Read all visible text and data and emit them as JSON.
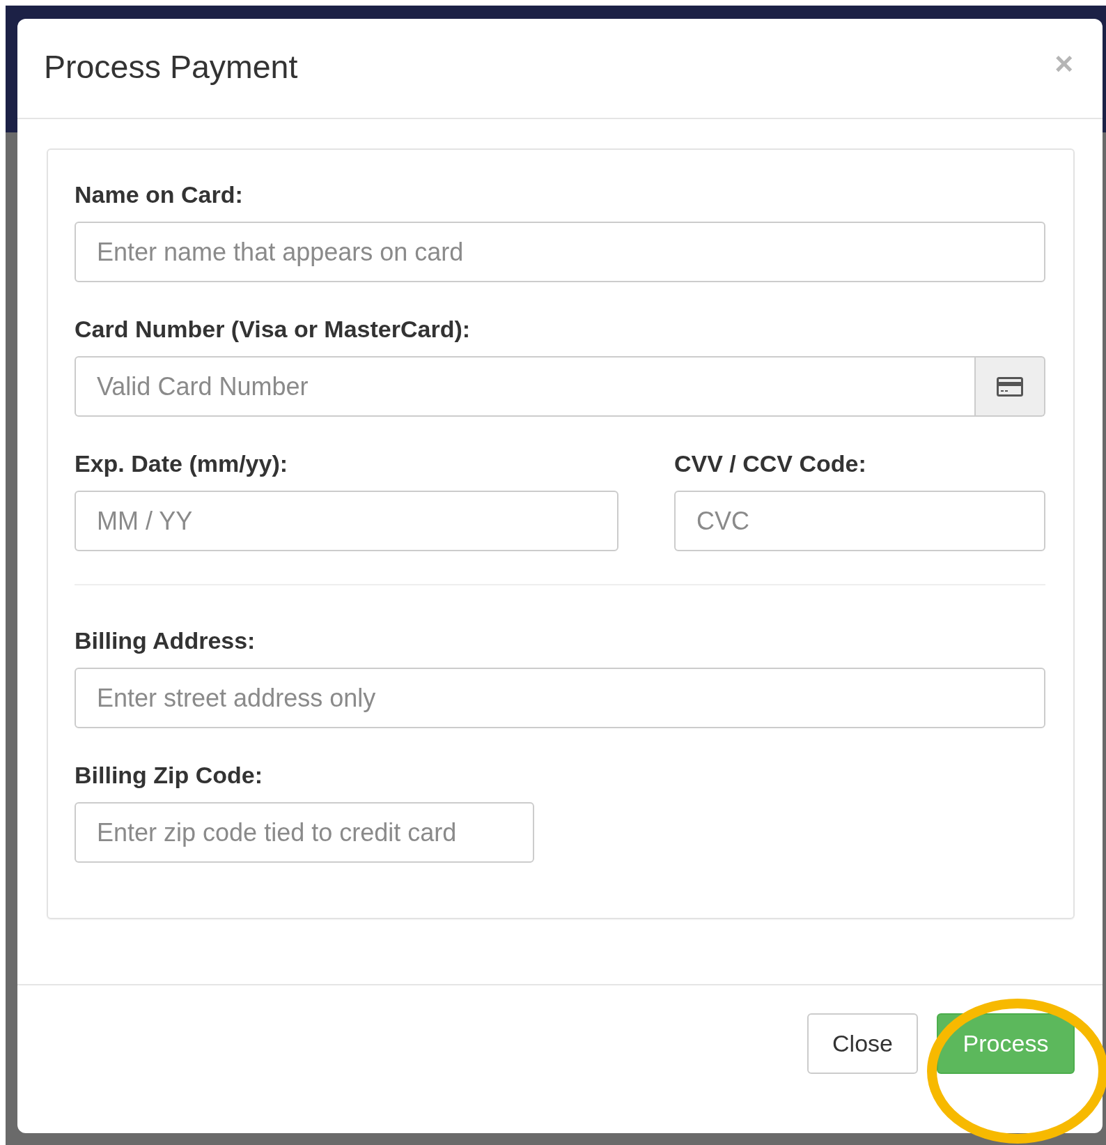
{
  "dialog": {
    "title": "Process Payment",
    "close_symbol": "×"
  },
  "rows": [
    {
      "kind": "single",
      "fields": [
        {
          "label": "Name on Card:",
          "placeholder": "Enter name that appears on card",
          "kind": "text"
        }
      ]
    },
    {
      "kind": "single",
      "fields": [
        {
          "label": "Card Number (Visa or MasterCard):",
          "placeholder": "Valid Card Number",
          "kind": "card-number"
        }
      ]
    },
    {
      "kind": "pair",
      "fields": [
        {
          "label": "Exp. Date (mm/yy):",
          "placeholder": "MM / YY",
          "kind": "text"
        },
        {
          "label": "CVV / CCV Code:",
          "placeholder": "CVC",
          "kind": "text"
        }
      ]
    },
    {
      "kind": "separator"
    },
    {
      "kind": "single",
      "fields": [
        {
          "label": "Billing Address:",
          "placeholder": "Enter street address only",
          "kind": "text"
        }
      ]
    },
    {
      "kind": "short",
      "fields": [
        {
          "label": "Billing Zip Code:",
          "placeholder": "Enter zip code tied to credit card",
          "kind": "text"
        }
      ]
    }
  ],
  "buttons": [
    {
      "label": "Close",
      "kind": "default",
      "highlighted": false
    },
    {
      "label": "Process",
      "kind": "primary",
      "highlighted": true
    }
  ]
}
